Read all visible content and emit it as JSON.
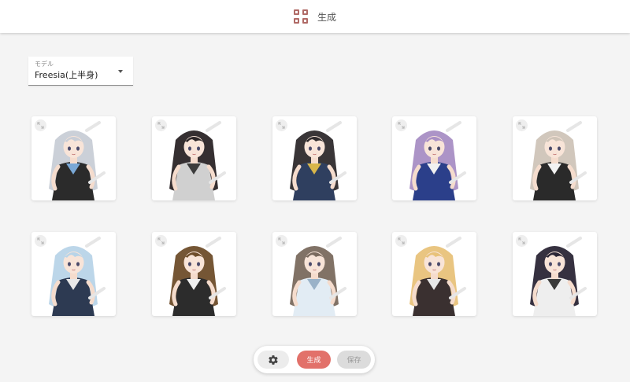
{
  "header": {
    "tab_label": "生成",
    "tab_icon": "grid-icon",
    "accent_color": "#b06a66"
  },
  "model_select": {
    "caption": "モデル",
    "value": "Freesia(上半身)"
  },
  "gallery": {
    "rows": 2,
    "columns": 5,
    "items": [
      {
        "hair": "#c8cdd6",
        "outfit": "#2b2b2b",
        "accent": "#7aa8d6"
      },
      {
        "hair": "#2a2426",
        "outfit": "#d0d0d0",
        "accent": "#3c3c3c"
      },
      {
        "hair": "#2e2a2c",
        "outfit": "#2f3f5f",
        "accent": "#d8b64a"
      },
      {
        "hair": "#a88ec4",
        "outfit": "#2b3f8a",
        "accent": "#f0f0f0"
      },
      {
        "hair": "#cfc4b8",
        "outfit": "#2a2a2a",
        "accent": "#f2f2f2"
      },
      {
        "hair": "#b8d4e8",
        "outfit": "#2d3a52",
        "accent": "#e8e8e8"
      },
      {
        "hair": "#6e4d2a",
        "outfit": "#2c2c2c",
        "accent": "#f0f0f0"
      },
      {
        "hair": "#7a6a5e",
        "outfit": "#e2ecf4",
        "accent": "#9ab2c8"
      },
      {
        "hair": "#e8c27a",
        "outfit": "#3a3030",
        "accent": "#e8e8e8"
      },
      {
        "hair": "#2b2636",
        "outfit": "#eeeeee",
        "accent": "#3a3a3a"
      }
    ]
  },
  "actions": {
    "settings_icon": "gear-icon",
    "generate_label": "生成",
    "generate_color": "#e2716a",
    "save_label": "保存",
    "save_enabled": false
  }
}
